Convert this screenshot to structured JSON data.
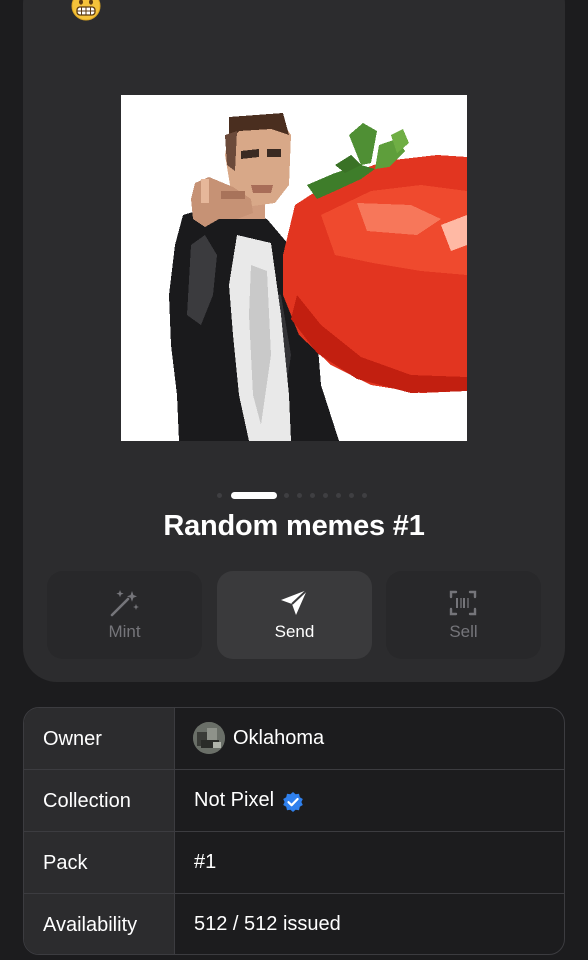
{
  "header": {
    "emoji_icon": "grimacing-face-icon"
  },
  "nft": {
    "image_icon": "pixel-art-man-with-tomato-image",
    "carousel": {
      "total": 10,
      "active_index": 1
    },
    "title": "Random memes #1"
  },
  "actions": [
    {
      "label": "Mint",
      "icon": "magic-wand-sparkles-icon",
      "enabled": false
    },
    {
      "label": "Send",
      "icon": "paper-plane-icon",
      "enabled": true
    },
    {
      "label": "Sell",
      "icon": "barcode-scan-icon",
      "enabled": false
    }
  ],
  "details": {
    "rows": [
      {
        "key": "Owner",
        "value": "Oklahoma"
      },
      {
        "key": "Collection",
        "value": "Not Pixel"
      },
      {
        "key": "Pack",
        "value": "#1"
      },
      {
        "key": "Availability",
        "value": "512 / 512 issued"
      }
    ]
  },
  "colors": {
    "background": "#1c1c1e",
    "card": "#2c2c2e",
    "verified_badge": "#2f80ed",
    "disabled_text": "#75757a"
  }
}
